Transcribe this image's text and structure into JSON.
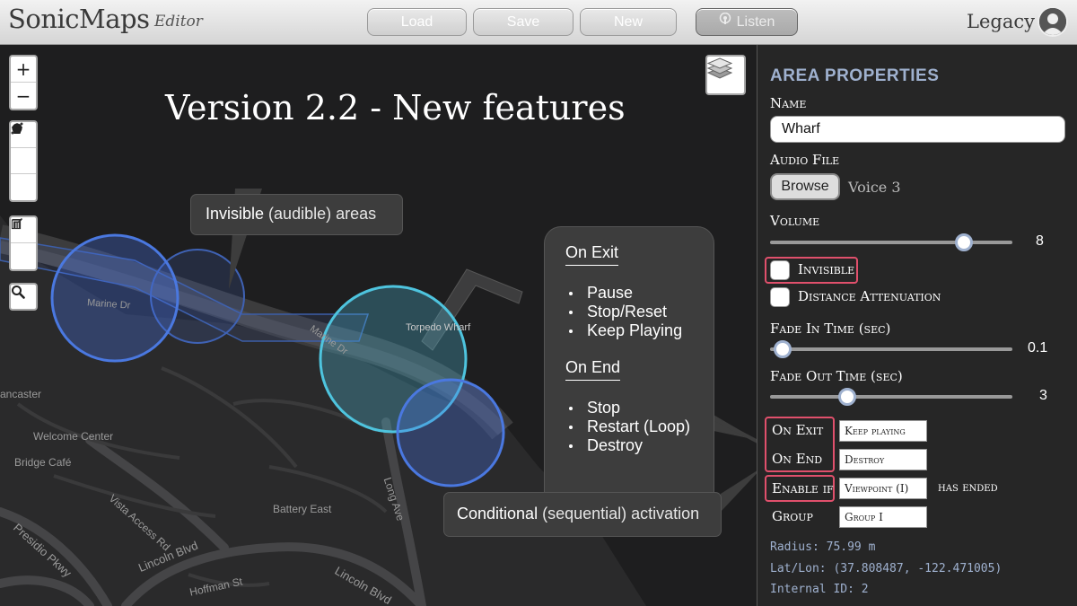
{
  "header": {
    "app_name": "SonicMaps",
    "app_subtitle": "Editor",
    "buttons": {
      "load": "Load",
      "save": "Save",
      "new": "New",
      "listen": "Listen"
    },
    "user_name": "Legacy"
  },
  "map": {
    "title": "Version 2.2 - New features",
    "zoom_in": "+",
    "zoom_out": "−",
    "tool_icons": [
      "polyline-icon",
      "polygon-icon",
      "circle-icon",
      "edit-icon",
      "trash-icon",
      "search-icon"
    ],
    "labels": {
      "marine_dr_1": "Marine Dr",
      "marine_dr_2": "Marine Dr",
      "torpedo_wharf": "Torpedo Wharf",
      "lancaster": "ancaster",
      "welcome_center": "Welcome Center",
      "bridge_cafe": "Bridge Café",
      "vista_access": "Vista Access Rd",
      "battery_east": "Battery East",
      "long_ave": "Long Ave",
      "lincoln_blvd_1": "Lincoln Blvd",
      "lincoln_blvd_2": "Lincoln Blvd",
      "presidio_pkwy": "Presidio Pkwy",
      "hoffman_st": "Hoffman St"
    },
    "callouts": {
      "invisible_bold": "Invisible",
      "invisible_rest": "(audible) areas",
      "conditional_bold": "Conditional",
      "conditional_rest": "(sequential) activation",
      "on_exit_heading": "On Exit",
      "on_exit_items": [
        "Pause",
        "Stop/Reset",
        "Keep Playing"
      ],
      "on_end_heading": "On End",
      "on_end_items": [
        "Stop",
        "Restart (Loop)",
        "Destroy"
      ]
    }
  },
  "panel": {
    "title": "AREA PROPERTIES",
    "name_label": "Name",
    "name_value": "Wharf",
    "audio_label": "Audio File",
    "browse_label": "Browse",
    "audio_file": "Voice 3",
    "volume_label": "Volume",
    "volume_value": "8",
    "volume_level": 0.8,
    "invisible_label": "Invisible",
    "distance_label": "Distance Attenuation",
    "fade_in_label": "Fade In Time (sec)",
    "fade_in_value": "0.1",
    "fade_in_level": 0.05,
    "fade_out_label": "Fade Out Time (sec)",
    "fade_out_value": "3",
    "fade_out_level": 0.32,
    "on_exit_label": "On Exit",
    "on_exit_value": "Keep playing",
    "on_end_label": "On End",
    "on_end_value": "Destroy",
    "enable_if_label": "Enable if",
    "enable_if_value": "Viewpoint (I)",
    "has_ended_label": "has ended",
    "group_label": "Group",
    "group_value": "Group I",
    "radius": "Radius: 75.99 m",
    "latlon": "Lat/Lon: (37.808487, -122.471005)",
    "internal_id": "Internal ID: 2"
  },
  "colors": {
    "accent": "#9fb1cf",
    "highlight": "#e0506c",
    "area_blue": "#4a78e0",
    "area_cyan": "#4ec4de"
  }
}
